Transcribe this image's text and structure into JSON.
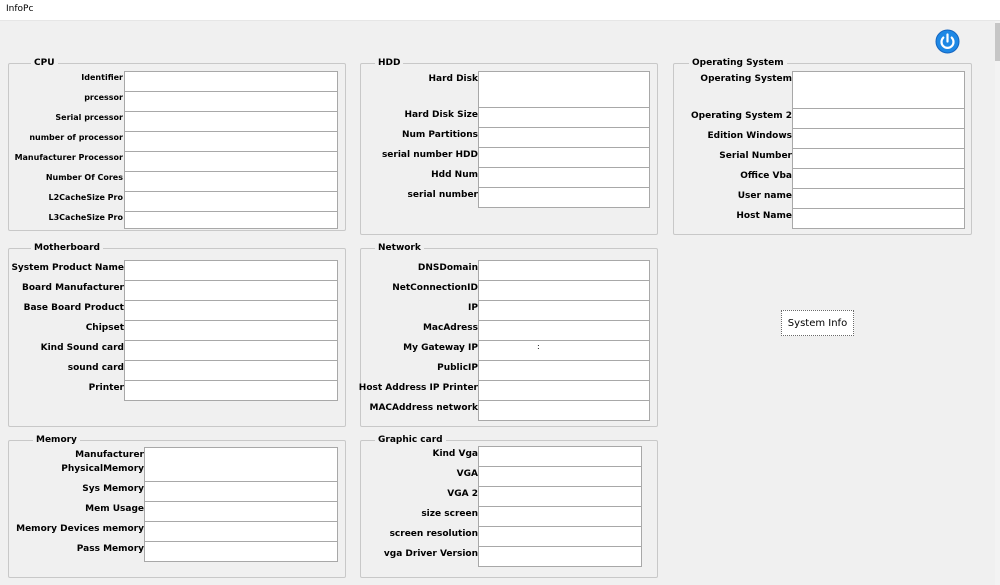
{
  "window": {
    "title": "InfoPc"
  },
  "groups": {
    "cpu": {
      "title": "CPU",
      "fields": [
        "Identifier",
        "prcessor",
        "Serial prcessor",
        "number of processor",
        "Manufacturer Processor",
        "Number Of Cores",
        "L2CacheSize Pro",
        "L3CacheSize Pro"
      ]
    },
    "hdd": {
      "title": "HDD",
      "fields": [
        "Hard Disk",
        "Hard Disk  Size",
        "Num Partitions",
        "serial number HDD",
        "Hdd Num",
        "serial number"
      ]
    },
    "os": {
      "title": "Operating System",
      "fields": [
        "Operating System",
        "Operating System 2",
        "Edition Windows",
        "Serial Number",
        "Office Vba",
        "User name",
        "Host Name"
      ]
    },
    "motherboard": {
      "title": "Motherboard",
      "fields": [
        "System Product Name",
        "Board Manufacturer",
        "Base Board Product",
        "Chipset",
        "Kind Sound card",
        "sound card",
        "Printer"
      ]
    },
    "network": {
      "title": "Network",
      "fields": [
        "DNSDomain",
        "NetConnectionID",
        "IP",
        "MacAdress",
        "My Gateway IP",
        "PublicIP",
        "Host Address IP Printer",
        "MACAddress network"
      ]
    },
    "memory": {
      "title": "Memory",
      "fields": [
        "Manufacturer PhysicalMemory",
        "Sys Memory",
        "Mem Usage",
        "Memory Devices memory",
        "Pass Memory"
      ]
    },
    "graphic": {
      "title": "Graphic card",
      "fields": [
        "Kind Vga",
        "VGA",
        "VGA 2",
        "size screen",
        "screen resolution",
        "vga Driver Version"
      ]
    }
  },
  "values": {
    "gateway_partial": ":"
  },
  "buttons": {
    "system_info": "System Info",
    "power_icon": "power-icon"
  },
  "colors": {
    "power_accent": "#1e88e5",
    "window_bg": "#f0f0f0"
  }
}
